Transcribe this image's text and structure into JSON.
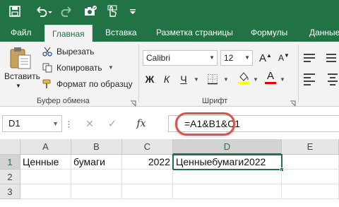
{
  "colors": {
    "brand": "#217346",
    "highlight": "#d9534f",
    "ribbon": "#f3f3f3"
  },
  "qat": {
    "icons": [
      "save-icon",
      "undo-icon",
      "redo-icon",
      "camera-icon",
      "touch-mode-icon"
    ]
  },
  "tabs": [
    {
      "label": "Файл",
      "active": false
    },
    {
      "label": "Главная",
      "active": true
    },
    {
      "label": "Вставка",
      "active": false
    },
    {
      "label": "Разметка страницы",
      "active": false
    },
    {
      "label": "Формулы",
      "active": false
    },
    {
      "label": "Данные",
      "active": false
    }
  ],
  "clipboard": {
    "paste_label": "Вставить",
    "cut_label": "Вырезать",
    "copy_label": "Копировать",
    "format_painter_label": "Формат по образцу",
    "group_label": "Буфер обмена"
  },
  "font": {
    "font_name": "Calibri",
    "font_size": "12",
    "bold": "Ж",
    "italic": "К",
    "underline": "Ч",
    "group_label": "Шрифт"
  },
  "formula_bar": {
    "name_box": "D1",
    "cancel_icon": "×",
    "enter_icon": "✓",
    "fx_label": "fx",
    "formula": "=A1&B1&C1"
  },
  "grid": {
    "columns": [
      "A",
      "B",
      "C",
      "D",
      "E"
    ],
    "rows": [
      "1",
      "2",
      "3"
    ],
    "cells": {
      "A1": "Ценные",
      "B1": "бумаги",
      "C1": "2022",
      "D1": "Ценныебумаги2022"
    },
    "active_cell": "D1"
  }
}
